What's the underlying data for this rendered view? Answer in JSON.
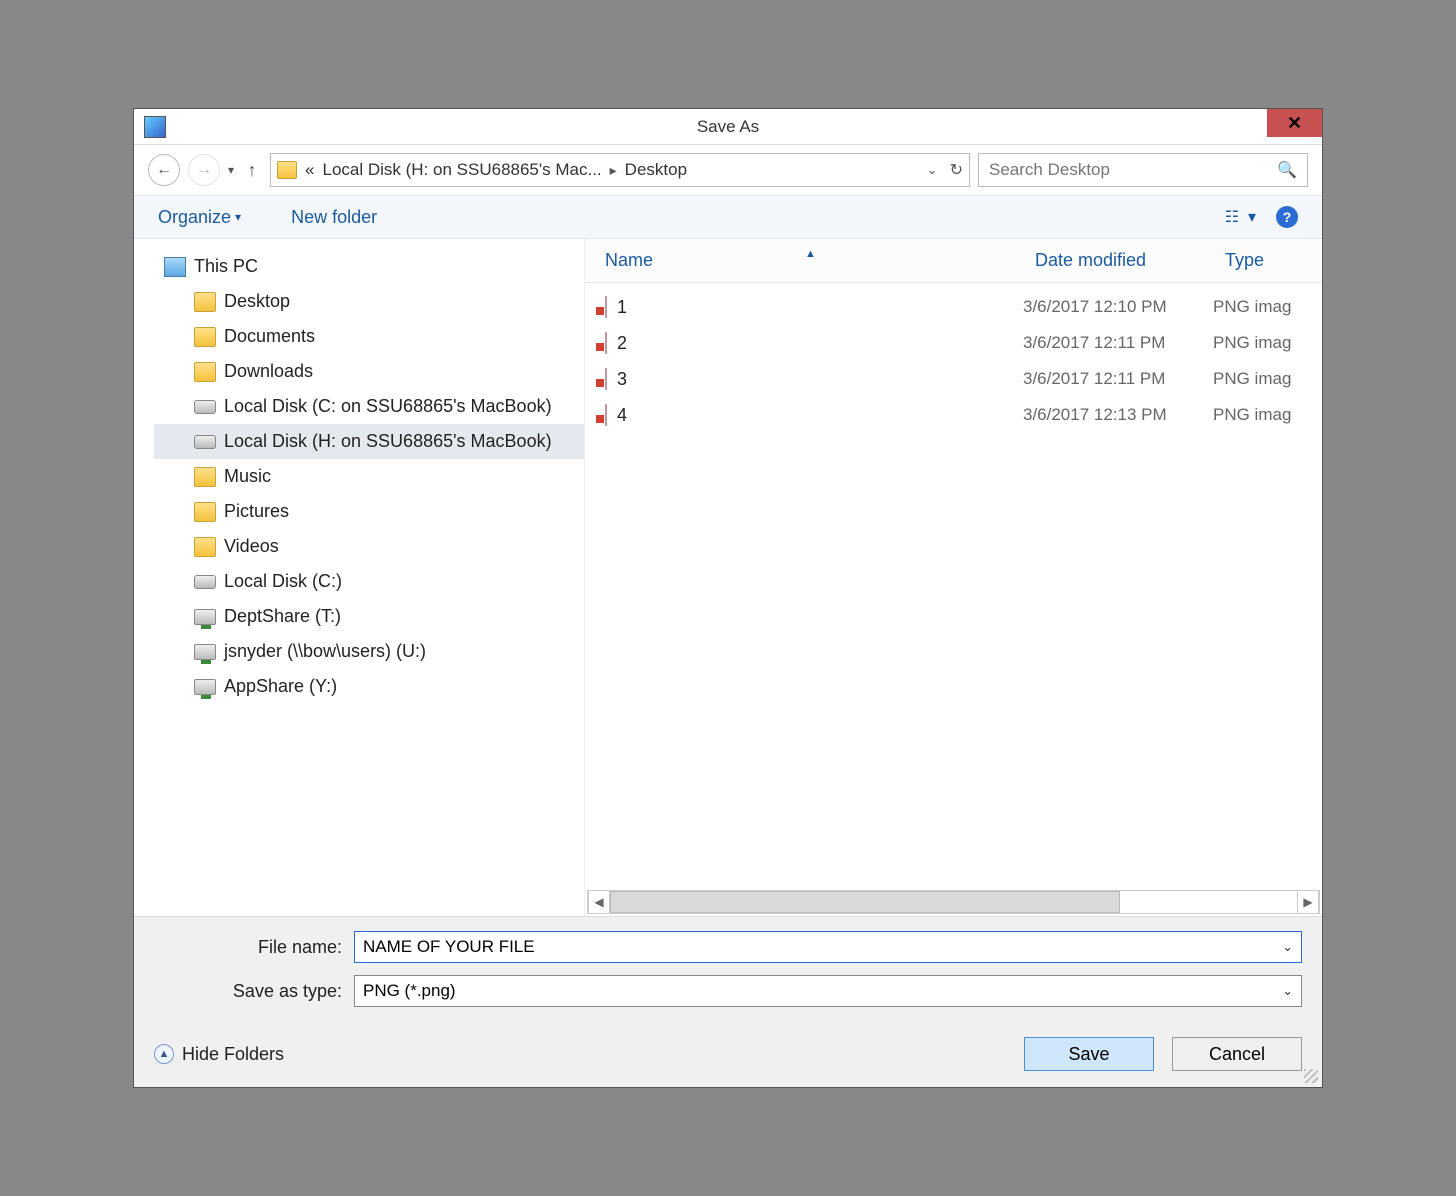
{
  "title": "Save As",
  "address": {
    "segment1": "Local Disk (H: on SSU68865's Mac...",
    "segment2": "Desktop"
  },
  "search": {
    "placeholder": "Search Desktop"
  },
  "toolbar": {
    "organize": "Organize",
    "new_folder": "New folder"
  },
  "columns": {
    "name": "Name",
    "date": "Date modified",
    "type": "Type"
  },
  "tree": {
    "root": "This PC",
    "items": [
      "Desktop",
      "Documents",
      "Downloads",
      "Local Disk (C: on SSU68865's MacBook)",
      "Local Disk (H: on SSU68865's MacBook)",
      "Music",
      "Pictures",
      "Videos",
      "Local Disk (C:)",
      "DeptShare (T:)",
      "jsnyder (\\\\bow\\users) (U:)",
      "AppShare (Y:)"
    ]
  },
  "files": [
    {
      "name": "1",
      "date": "3/6/2017 12:10 PM",
      "type": "PNG imag"
    },
    {
      "name": "2",
      "date": "3/6/2017 12:11 PM",
      "type": "PNG imag"
    },
    {
      "name": "3",
      "date": "3/6/2017 12:11 PM",
      "type": "PNG imag"
    },
    {
      "name": "4",
      "date": "3/6/2017 12:13 PM",
      "type": "PNG imag"
    }
  ],
  "form": {
    "filename_label": "File name:",
    "filename_value": "NAME OF YOUR FILE",
    "type_label": "Save as type:",
    "type_value": "PNG (*.png)"
  },
  "footer": {
    "hide_folders": "Hide Folders",
    "save": "Save",
    "cancel": "Cancel"
  }
}
